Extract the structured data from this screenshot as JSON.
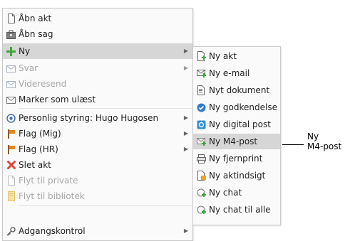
{
  "main_menu": {
    "items": [
      {
        "label": "Åbn akt",
        "icon": "document-icon"
      },
      {
        "label": "Åbn sag",
        "icon": "case-icon"
      },
      {
        "label": "Ny",
        "icon": "plus-icon",
        "has_submenu": true
      },
      {
        "label": "Svar",
        "icon": "reply-icon",
        "has_submenu": true,
        "disabled": true
      },
      {
        "label": "Videresend",
        "icon": "forward-icon",
        "disabled": true
      },
      {
        "label": "Marker som ulæst",
        "icon": "envelope-icon"
      },
      {
        "label": "Personlig styring: Hugo Hugosen",
        "icon": "eye-icon",
        "has_submenu": true
      },
      {
        "label": "Flag (Mig)",
        "icon": "flag-icon",
        "has_submenu": true
      },
      {
        "label": "Flag (HR)",
        "icon": "flag-icon",
        "has_submenu": true
      },
      {
        "label": "Slet akt",
        "icon": "delete-icon"
      },
      {
        "label": "Flyt til private",
        "icon": "move-private-icon",
        "disabled": true
      },
      {
        "label": "Flyt til bibliotek",
        "icon": "move-library-icon",
        "disabled": true
      },
      {
        "label": "Adgangskontrol",
        "icon": "key-icon",
        "has_submenu": true
      }
    ]
  },
  "sub_menu": {
    "items": [
      {
        "label": "Ny akt",
        "icon": "new-document-icon"
      },
      {
        "label": "Ny e-mail",
        "icon": "new-email-icon"
      },
      {
        "label": "Nyt dokument",
        "icon": "new-file-icon"
      },
      {
        "label": "Ny godkendelse",
        "icon": "approval-icon"
      },
      {
        "label": "Ny digital post",
        "icon": "digital-post-icon"
      },
      {
        "label": "Ny M4-post",
        "icon": "m4-post-icon"
      },
      {
        "label": "Ny fjernprint",
        "icon": "remote-print-icon"
      },
      {
        "label": "Ny aktindsigt",
        "icon": "access-request-icon"
      },
      {
        "label": "Ny chat",
        "icon": "chat-icon"
      },
      {
        "label": "Ny chat til alle",
        "icon": "chat-all-icon"
      }
    ]
  },
  "callout": {
    "line1": "Ny",
    "line2": "M4-post"
  },
  "colors": {
    "highlight": "#d6d6d6",
    "plus_green": "#3aa935",
    "flag_orange": "#e8841a",
    "delete_red": "#e0463c",
    "disabled_text": "#a8a8a8"
  }
}
